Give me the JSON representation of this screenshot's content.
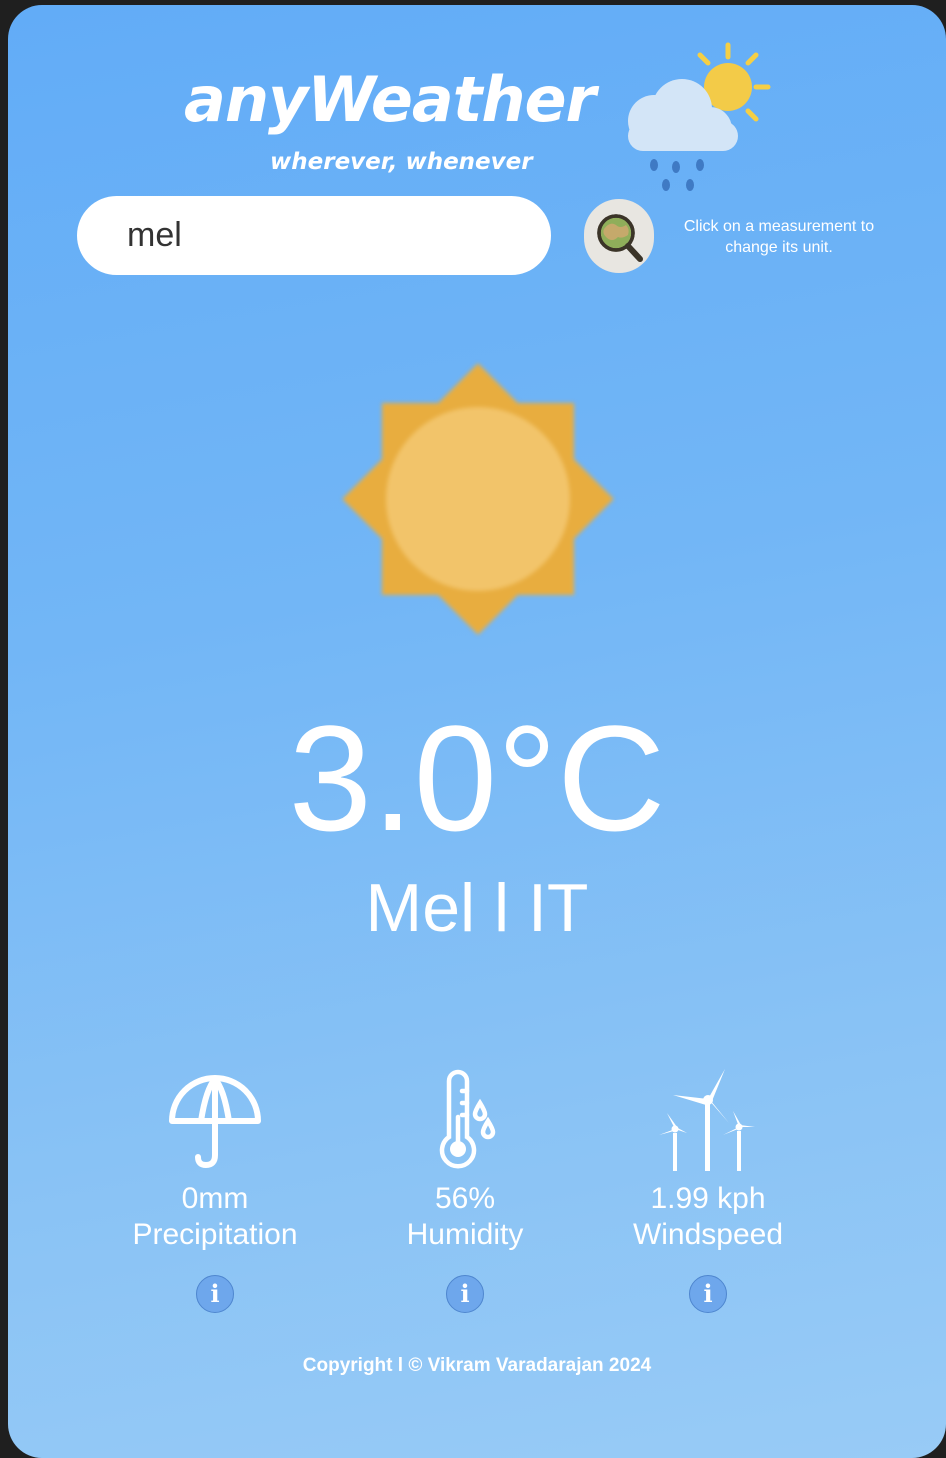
{
  "brand": {
    "title": "anyWeather",
    "tagline": "wherever, whenever"
  },
  "search": {
    "value": "mel",
    "button_icon": "globe-magnifier-icon"
  },
  "hint": "Click on a measurement to change its unit.",
  "current": {
    "icon": "sun-icon",
    "temperature": "3.0°C",
    "location": "Mel l IT"
  },
  "stats": [
    {
      "icon": "umbrella-icon",
      "value": "0mm",
      "label": "Precipitation",
      "info_icon": "info-icon"
    },
    {
      "icon": "thermometer-droplets-icon",
      "value": "56%",
      "label": "Humidity",
      "info_icon": "info-icon"
    },
    {
      "icon": "wind-turbines-icon",
      "value": "1.99 kph",
      "label": "Windspeed",
      "info_icon": "info-icon"
    }
  ],
  "footer": "Copyright l © Vikram Varadarajan 2024",
  "colors": {
    "background_top": "#62acf7",
    "background_bottom": "#98cbf6",
    "sun": "#e8ad3f",
    "sun_core": "#f2c46a",
    "info_button": "#6ea7ec"
  }
}
